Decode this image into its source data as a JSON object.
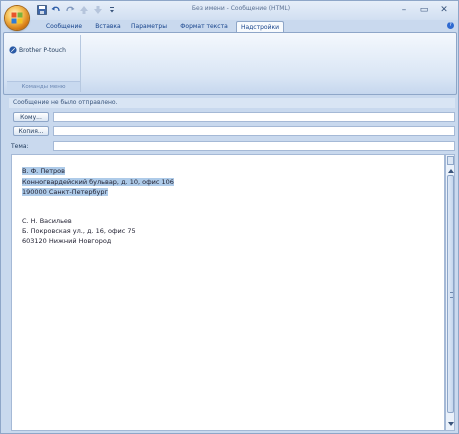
{
  "window": {
    "title": "Без имени - Сообщение (HTML)",
    "minimize": "–",
    "maximize": "▭",
    "close": "✕"
  },
  "ribbon_tabs": [
    {
      "label": "Сообщение"
    },
    {
      "label": "Вставка"
    },
    {
      "label": "Параметры"
    },
    {
      "label": "Формат текста"
    },
    {
      "label": "Надстройки"
    }
  ],
  "ribbon": {
    "brother_button": "Brother P-touch",
    "group_label": "Команды меню"
  },
  "infobar": "Сообщение не было отправлено.",
  "fields": {
    "to_button": "Кому...",
    "cc_button": "Копия...",
    "subject_label": "Тема:",
    "to_value": "",
    "cc_value": "",
    "subject_value": ""
  },
  "body": {
    "lines": [
      "В. Ф. Петров",
      "Конногвардейский бульвар, д. 10, офис 106",
      "190000 Санкт-Петербург",
      "С. Н. Васильев",
      "Б. Покровская ул., д. 16, офис 75",
      "603120 Нижний Новгород"
    ]
  },
  "colors": {
    "accent": "#15428b",
    "selection": "#aecbe9",
    "frame": "#c9d9ee"
  }
}
